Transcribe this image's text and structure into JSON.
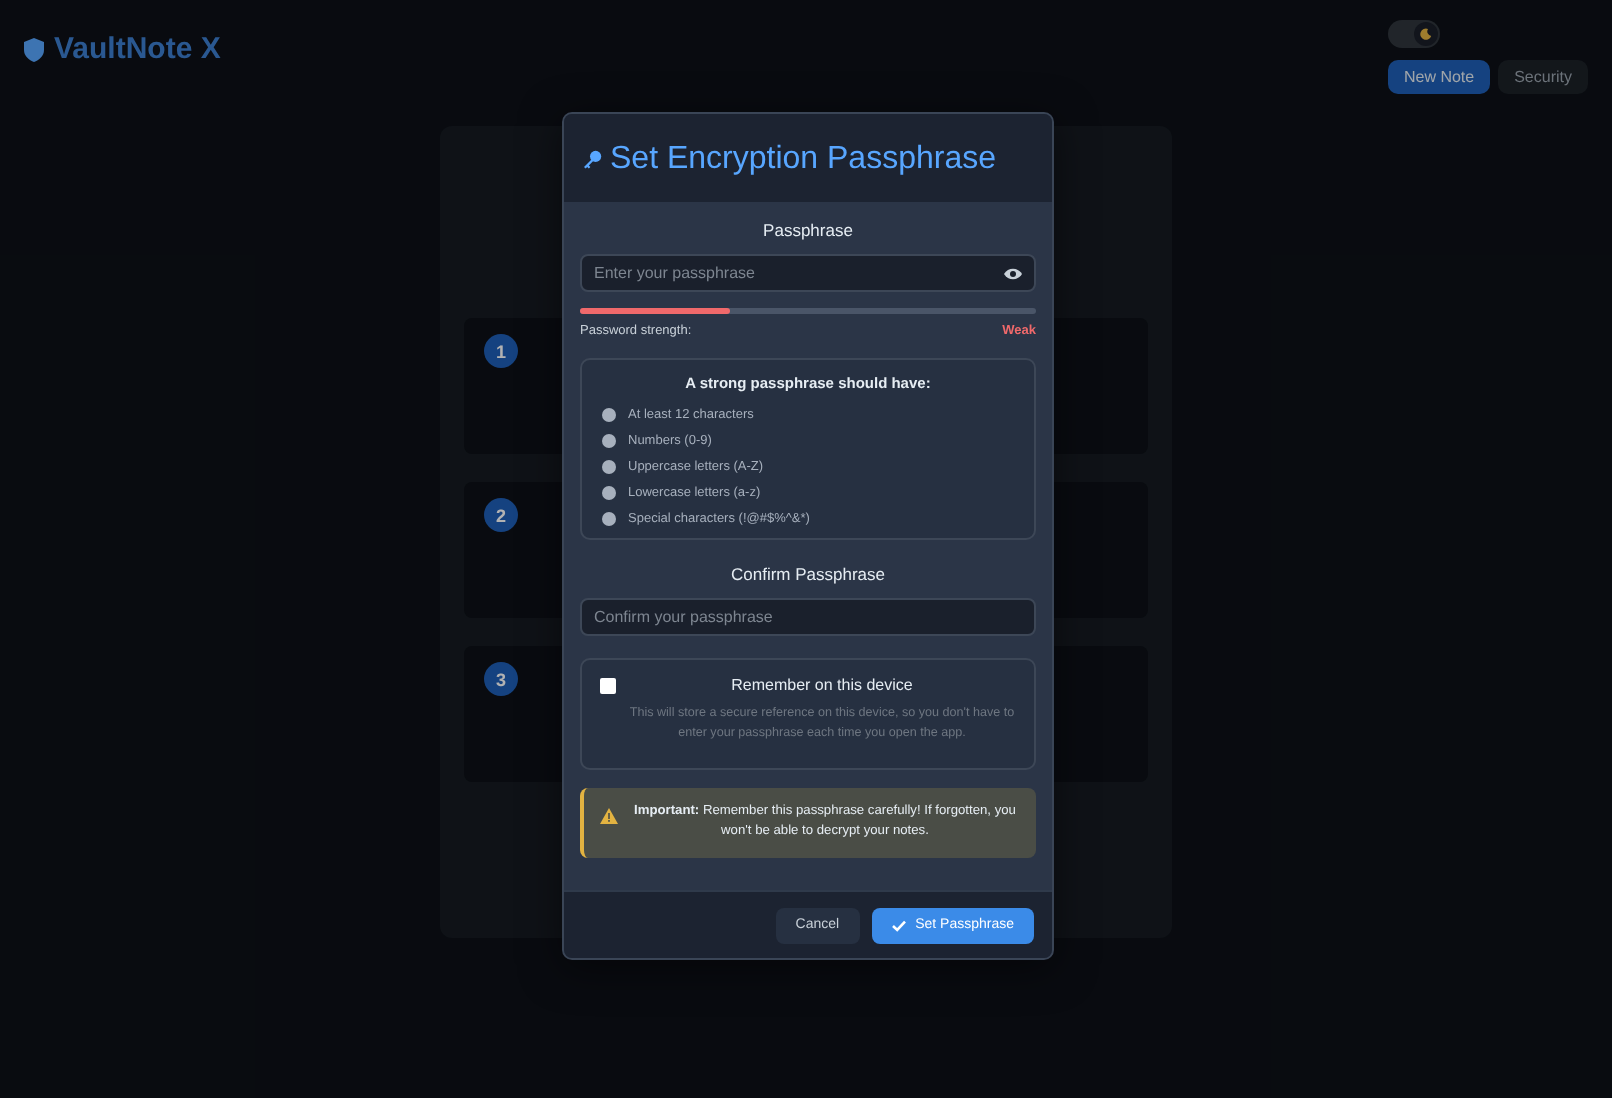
{
  "app": {
    "title": "VaultNote X",
    "dark_mode": true,
    "buttons": [
      {
        "label": "New Note",
        "kind": "primary"
      },
      {
        "label": "Security",
        "kind": "secondary"
      }
    ],
    "steps": [
      "1",
      "2",
      "3"
    ]
  },
  "dialog": {
    "title": "Set Encryption Passphrase",
    "passphrase": {
      "label": "Passphrase",
      "placeholder": "Enter your passphrase",
      "strength_label": "Password strength:",
      "strength": "Weak",
      "level": 0.33
    },
    "requirements": {
      "title": "A strong passphrase should have:",
      "items": [
        {
          "label": "At least 12 characters",
          "met": false
        },
        {
          "label": "Numbers (0-9)",
          "met": false
        },
        {
          "label": "Uppercase letters (A-Z)",
          "met": false
        },
        {
          "label": "Lowercase letters (a-z)",
          "met": false
        },
        {
          "label": "Special characters (!@#$%^&*)",
          "met": false
        }
      ]
    },
    "confirm": {
      "label": "Confirm Passphrase",
      "placeholder": "Confirm your passphrase"
    },
    "remember": {
      "label": "Remember on this device",
      "checked": false,
      "description": "This will store a secure reference on this device, so you don't have to enter your passphrase each time you open the app."
    },
    "warning": {
      "text": "**Important:**  Remember this passphrase carefully! If forgotten, you won't be able to decrypt your notes."
    },
    "buttons": [
      {
        "label": "Cancel",
        "kind": "secondary"
      },
      {
        "label": "Set Passphrase",
        "kind": "primary"
      }
    ]
  }
}
